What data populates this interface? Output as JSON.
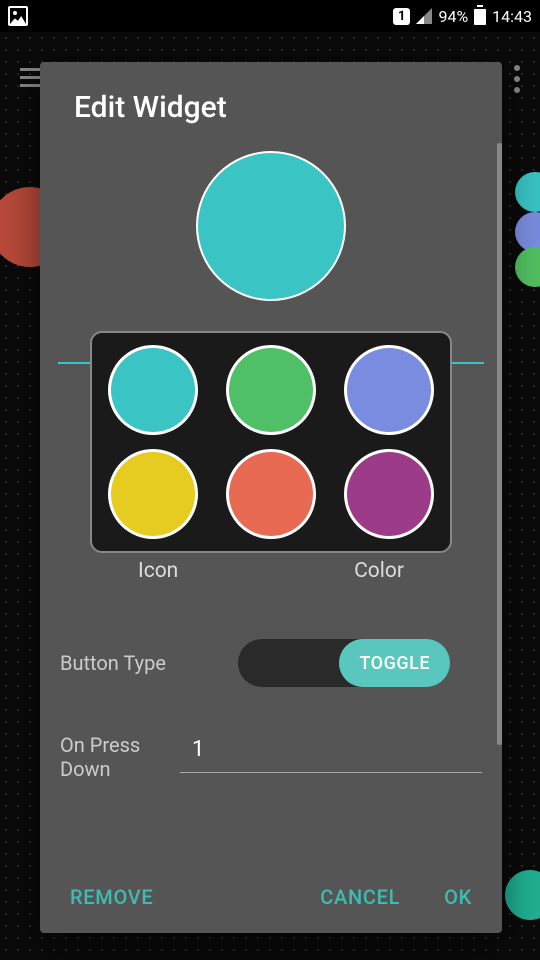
{
  "status_bar": {
    "sim": "1",
    "battery_pct": "94%",
    "time": "14:43"
  },
  "dialog": {
    "title": "Edit Widget",
    "preview_color": "#3ac4c4",
    "palette": [
      "#3ac4c4",
      "#4fc066",
      "#7a8ce0",
      "#e6cb20",
      "#e86a52",
      "#9c3b88"
    ],
    "selector": {
      "icon_label": "Icon",
      "color_label": "Color"
    },
    "button_type": {
      "label": "Button Type",
      "value": "TOGGLE"
    },
    "on_press_down": {
      "label": "On Press Down",
      "value": "1"
    },
    "footer": {
      "remove": "REMOVE",
      "cancel": "CANCEL",
      "ok": "OK"
    }
  }
}
